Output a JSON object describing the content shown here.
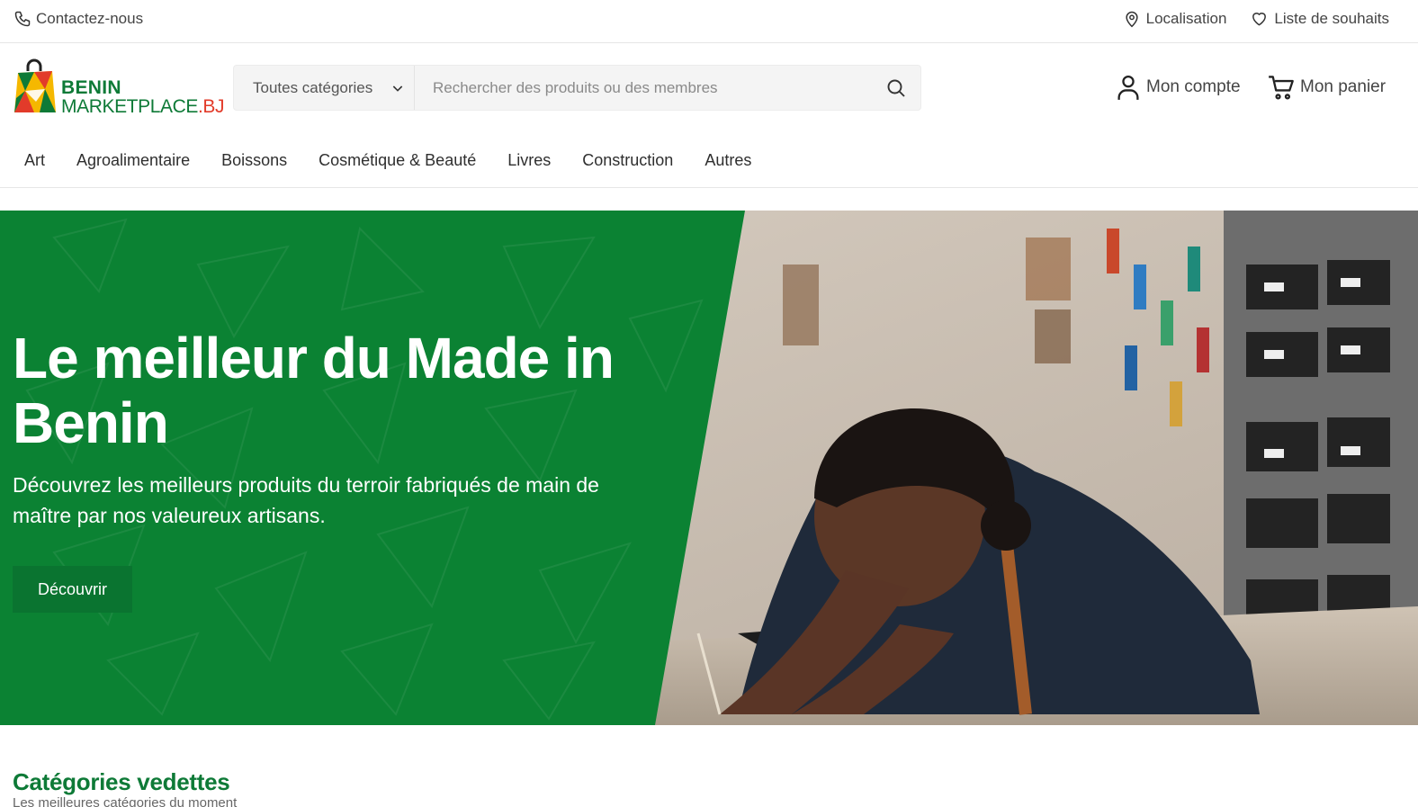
{
  "topbar": {
    "contact_label": "Contactez-nous",
    "location_label": "Localisation",
    "wishlist_label": "Liste de souhaits"
  },
  "logo": {
    "line1": "BENIN",
    "line2_main": "MARKETPLACE",
    "line2_suffix": ".BJ"
  },
  "search": {
    "category_label": "Toutes catégories",
    "placeholder": "Rechercher des produits ou des membres"
  },
  "account": {
    "account_label": "Mon compte",
    "cart_label": "Mon panier"
  },
  "nav": {
    "items": [
      {
        "label": "Art"
      },
      {
        "label": "Agroalimentaire"
      },
      {
        "label": "Boissons"
      },
      {
        "label": "Cosmétique & Beauté"
      },
      {
        "label": "Livres"
      },
      {
        "label": "Construction"
      },
      {
        "label": "Autres"
      }
    ]
  },
  "hero": {
    "title": "Le meilleur du Made in Benin",
    "subtitle": "Découvrez les meilleurs produits du terroir fabriqués de main de maître par nos valeureux artisans.",
    "cta_label": "Découvrir"
  },
  "featured": {
    "title": "Catégories vedettes",
    "subtitle": "Les meilleures catégories du moment"
  },
  "colors": {
    "brand_green": "#0b8233",
    "button_green": "#0a7430",
    "brand_red": "#e23b2a",
    "brand_yellow": "#f5b800"
  },
  "icons": [
    "phone-icon",
    "location-pin-icon",
    "heart-icon",
    "chevron-down-icon",
    "search-icon",
    "user-icon",
    "cart-icon"
  ]
}
